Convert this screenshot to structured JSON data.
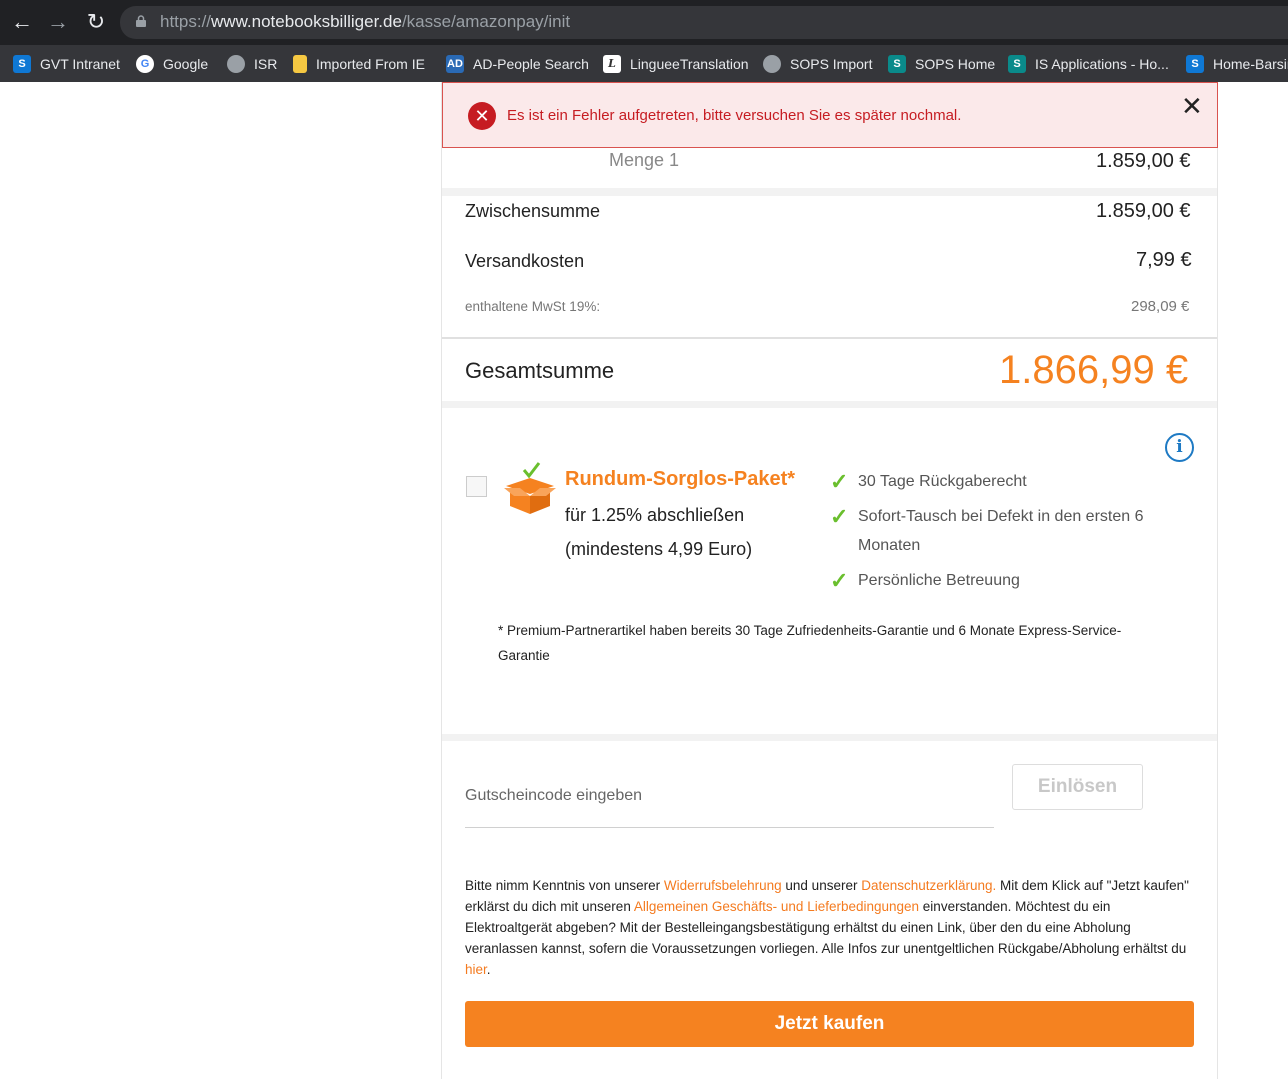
{
  "browser": {
    "url_prefix": "https://",
    "url_host": "www.notebooksbilliger.de",
    "url_path": "/kasse/amazonpay/init"
  },
  "bookmarks": [
    {
      "label": "GVT Intranet",
      "icon": "sharepoint-icon",
      "color": "#0f78d4"
    },
    {
      "label": "Google",
      "icon": "google-icon",
      "color": "#ffffff"
    },
    {
      "label": "ISR",
      "icon": "globe-icon",
      "color": "#9aa0a6"
    },
    {
      "label": "Imported From IE",
      "icon": "folder-icon",
      "color": "#f5c842"
    },
    {
      "label": "AD-People Search",
      "icon": "ad-icon",
      "color": "#2a6ab5"
    },
    {
      "label": "LingueeTranslation",
      "icon": "linguee-icon",
      "color": "#ffffff"
    },
    {
      "label": "SOPS Import",
      "icon": "globe-icon",
      "color": "#9aa0a6"
    },
    {
      "label": "SOPS Home",
      "icon": "sharepoint-icon",
      "color": "#0a8a8a"
    },
    {
      "label": "IS Applications - Ho...",
      "icon": "sharepoint-icon",
      "color": "#0a8a8a"
    },
    {
      "label": "Home-Barsin",
      "icon": "sharepoint-icon",
      "color": "#0f78d4"
    }
  ],
  "alert": {
    "message": "Es ist ein Fehler aufgetreten, bitte versuchen Sie es später nochmal.",
    "close": "✕"
  },
  "summary": {
    "quantity": "Menge 1",
    "item_price": "1.859,00 €",
    "subtotal_label": "Zwischensumme",
    "subtotal_value": "1.859,00 €",
    "shipping_label": "Versandkosten",
    "shipping_value": "7,99 €",
    "vat_label": "enthaltene MwSt 19%:",
    "vat_value": "298,09 €",
    "total_label": "Gesamtsumme",
    "total_value": "1.866,99 €"
  },
  "package": {
    "title": "Rundum-Sorglos-Paket*",
    "line1": "für 1.25% abschließen",
    "line2": "(mindestens 4,99 Euro)",
    "benefits": [
      "30 Tage Rückgaberecht",
      "Sofort-Tausch bei Defekt in den ersten 6",
      "Monaten",
      "Persönliche Betreuung"
    ],
    "footnote_line1": "* Premium-Partnerartikel haben bereits 30 Tage Zufriedenheits-Garantie und 6 Monate Express-Service-",
    "footnote_line2": "Garantie",
    "info_icon": "i"
  },
  "voucher": {
    "placeholder": "Gutscheincode eingeben",
    "button": "Einlösen"
  },
  "legal": {
    "t1": "Bitte nimm Kenntnis von unserer ",
    "link1": "Widerrufsbelehrung",
    "t2": " und unserer ",
    "link2": "Datenschutzerklärung.",
    "t3": " Mit dem Klick auf \"Jetzt kaufen\" erklärst du dich mit unseren ",
    "link3": "Allgemeinen Geschäfts- und Lieferbedingungen",
    "t4": " einverstanden. Möchtest du ein Elektroaltgerät abgeben? Mit der Bestelleingangsbestätigung erhältst du einen Link, über den du eine Abholung veranlassen kannst, sofern die Voraussetzungen vorliegen. Alle Infos zur unentgeltlichen Rückgabe/Abholung erhältst du ",
    "link4": "hier",
    "t5": "."
  },
  "buy_button": "Jetzt kaufen",
  "colors": {
    "accent": "#f58220",
    "error": "#c61c22",
    "check": "#6abf2e",
    "info": "#1e7ac4"
  }
}
